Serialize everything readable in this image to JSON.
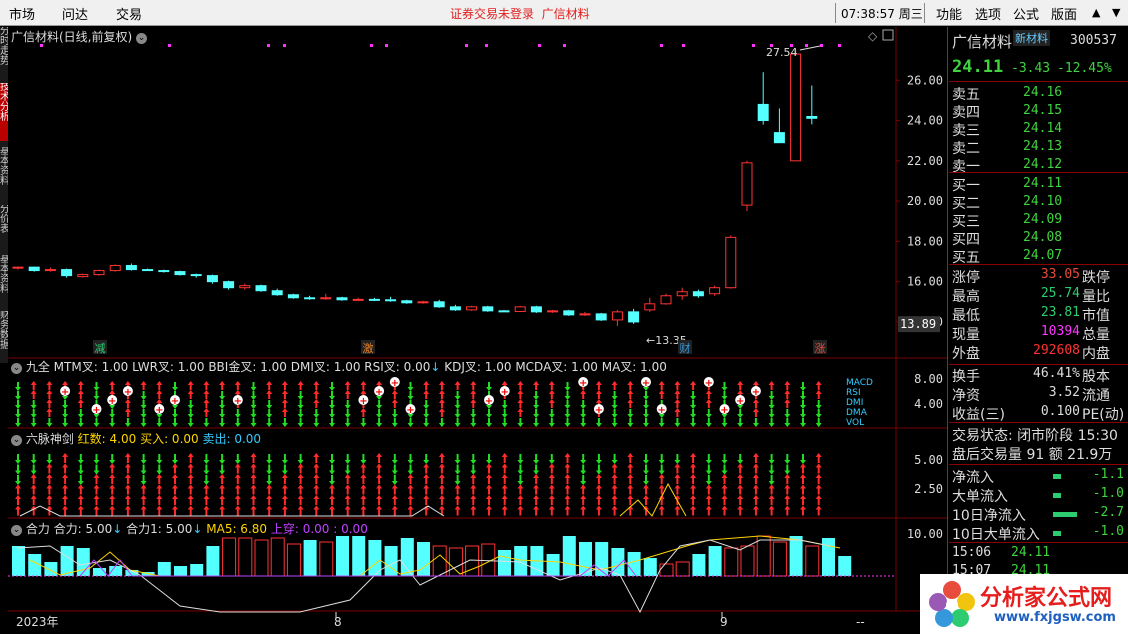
{
  "menu": {
    "left": [
      "市场",
      "问达",
      "交易"
    ],
    "right": [
      "功能",
      "选项",
      "公式",
      "版面"
    ],
    "notice": "证券交易未登录",
    "notice_stock": "广信材料",
    "clock": "07:38:57 周三"
  },
  "leftbar": [
    "分时走势",
    "技术分析",
    "基本资料",
    "分价表",
    "基本资料",
    "财务数据"
  ],
  "chart": {
    "title": "广信材料(日线,前复权)",
    "high_label": "27.54",
    "low_label": "13.35",
    "current_tag": "13.89",
    "y_ticks": [
      "26.00",
      "24.00",
      "22.00",
      "20.00",
      "18.00",
      "16.00",
      "14.00"
    ],
    "markers": [
      {
        "text": "减",
        "color": "#2ecc71"
      },
      {
        "text": "激",
        "color": "#e67e22"
      },
      {
        "text": "财",
        "color": "#3498db"
      },
      {
        "text": "涨",
        "color": "#e74c3c"
      }
    ],
    "x_labels": [
      "2023年",
      "8",
      "9"
    ]
  },
  "chart_data": {
    "type": "candlestick",
    "ylim": [
      13.5,
      27.8
    ],
    "candles": [
      [
        16.7,
        16.75,
        16.6,
        16.72
      ],
      [
        16.72,
        16.75,
        16.5,
        16.55
      ],
      [
        16.55,
        16.7,
        16.5,
        16.6
      ],
      [
        16.6,
        16.65,
        16.2,
        16.3
      ],
      [
        16.25,
        16.4,
        16.2,
        16.35
      ],
      [
        16.35,
        16.6,
        16.3,
        16.55
      ],
      [
        16.55,
        16.85,
        16.5,
        16.8
      ],
      [
        16.8,
        16.9,
        16.55,
        16.6
      ],
      [
        16.6,
        16.65,
        16.55,
        16.58
      ],
      [
        16.55,
        16.6,
        16.45,
        16.5
      ],
      [
        16.5,
        16.55,
        16.3,
        16.35
      ],
      [
        16.35,
        16.4,
        16.2,
        16.3
      ],
      [
        16.3,
        16.35,
        15.9,
        16.0
      ],
      [
        16.0,
        16.05,
        15.6,
        15.7
      ],
      [
        15.7,
        15.9,
        15.6,
        15.8
      ],
      [
        15.8,
        15.85,
        15.5,
        15.55
      ],
      [
        15.55,
        15.65,
        15.3,
        15.35
      ],
      [
        15.35,
        15.4,
        15.15,
        15.2
      ],
      [
        15.2,
        15.3,
        15.1,
        15.15
      ],
      [
        15.15,
        15.4,
        15.1,
        15.2
      ],
      [
        15.2,
        15.25,
        15.05,
        15.1
      ],
      [
        15.1,
        15.2,
        15.05,
        15.12
      ],
      [
        15.12,
        15.2,
        15.05,
        15.1
      ],
      [
        15.1,
        15.25,
        15.0,
        15.05
      ],
      [
        15.05,
        15.1,
        14.9,
        14.95
      ],
      [
        14.95,
        15.05,
        14.9,
        15.0
      ],
      [
        15.0,
        15.1,
        14.7,
        14.75
      ],
      [
        14.75,
        14.85,
        14.55,
        14.6
      ],
      [
        14.6,
        14.8,
        14.55,
        14.75
      ],
      [
        14.75,
        14.8,
        14.5,
        14.55
      ],
      [
        14.55,
        14.6,
        14.5,
        14.52
      ],
      [
        14.52,
        14.8,
        14.5,
        14.75
      ],
      [
        14.75,
        14.8,
        14.45,
        14.5
      ],
      [
        14.5,
        14.6,
        14.45,
        14.55
      ],
      [
        14.55,
        14.6,
        14.3,
        14.35
      ],
      [
        14.35,
        14.5,
        14.3,
        14.4
      ],
      [
        14.4,
        14.45,
        14.05,
        14.1
      ],
      [
        14.1,
        14.6,
        13.8,
        14.5
      ],
      [
        14.5,
        14.65,
        13.9,
        14.0
      ],
      [
        14.6,
        15.2,
        14.5,
        14.9
      ],
      [
        14.9,
        15.4,
        14.85,
        15.3
      ],
      [
        15.3,
        15.7,
        15.1,
        15.5
      ],
      [
        15.5,
        15.6,
        15.2,
        15.3
      ],
      [
        15.4,
        15.8,
        15.3,
        15.7
      ],
      [
        15.7,
        18.3,
        15.65,
        18.2
      ],
      [
        19.8,
        22.0,
        19.5,
        21.9
      ],
      [
        24.8,
        26.4,
        23.8,
        24.0
      ],
      [
        23.4,
        24.6,
        22.9,
        22.9
      ],
      [
        22.0,
        27.54,
        22.0,
        27.3
      ],
      [
        24.2,
        25.74,
        23.81,
        24.11
      ]
    ]
  },
  "ind1": {
    "title": "九全",
    "params": [
      "MTM叉: 1.00",
      "LWR叉: 1.00",
      "BBI金叉: 1.00",
      "DMI叉: 1.00",
      "RSI叉: 0.00",
      "KDJ叉: 1.00",
      "MCDA叉: 1.00",
      "MA叉: 1.00"
    ],
    "ticks": [
      "8.00",
      "4.00"
    ],
    "legend": [
      "MACD",
      "RSI",
      "DMI",
      "DMA",
      "VOL"
    ]
  },
  "ind2": {
    "title": "六脉神剑",
    "params": [
      {
        "t": "红数: 4.00",
        "c": "#ffd400"
      },
      {
        "t": "买入: 0.00",
        "c": "#ffd400"
      },
      {
        "t": "卖出: 0.00",
        "c": "#33ccff"
      }
    ],
    "ticks": [
      "5.00",
      "2.50"
    ]
  },
  "ind3": {
    "title": "合力",
    "params": [
      {
        "t": "合力: 5.00",
        "c": "#ddd"
      },
      {
        "t": "合力1: 5.00",
        "c": "#ddd"
      },
      {
        "t": "MA5: 6.80",
        "c": "#ffd400"
      },
      {
        "t": "上穿: 0.00 : 0.00",
        "c": "#c040ff"
      }
    ],
    "ticks": [
      "10.00"
    ]
  },
  "quote": {
    "name": "广信材料",
    "tag": "新材料",
    "code": "300537",
    "price": "24.11",
    "change": "-3.43",
    "pct": "-12.45%",
    "sell": [
      [
        "卖五",
        "24.16",
        ""
      ],
      [
        "卖四",
        "24.15",
        ""
      ],
      [
        "卖三",
        "24.14",
        ""
      ],
      [
        "卖二",
        "24.13",
        ""
      ],
      [
        "卖一",
        "24.12",
        ""
      ]
    ],
    "buy": [
      [
        "买一",
        "24.11",
        ""
      ],
      [
        "买二",
        "24.10",
        ""
      ],
      [
        "买三",
        "24.09",
        ""
      ],
      [
        "买四",
        "24.08",
        ""
      ],
      [
        "买五",
        "24.07",
        ""
      ]
    ],
    "stats": [
      [
        "涨停",
        "33.05",
        "#e74c3c",
        "跌停"
      ],
      [
        "最高",
        "25.74",
        "#2ecc71",
        "量比"
      ],
      [
        "最低",
        "23.81",
        "#2ecc71",
        "市值"
      ],
      [
        "现量",
        "10394",
        "#ff33ff",
        "总量"
      ],
      [
        "外盘",
        "292608",
        "#ff3333",
        "内盘"
      ]
    ],
    "stats2": [
      [
        "换手",
        "46.41%",
        "#ddd",
        "股本"
      ],
      [
        "净资",
        "3.52",
        "#ddd",
        "流通"
      ],
      [
        "收益(三)",
        "0.100",
        "#ddd",
        "PE(动)"
      ]
    ],
    "trade_status": "交易状态: 闭市阶段 15:30",
    "after": "盘后交易量 91 额 21.9万",
    "flows": [
      [
        "净流入",
        "-1.1"
      ],
      [
        "大单流入",
        "-1.0"
      ],
      [
        "10日净流入",
        "-2.7"
      ],
      [
        "10日大单流入",
        "-1.0"
      ]
    ],
    "ticks": [
      [
        "15:06",
        "24.11"
      ],
      [
        "15:07",
        "24.11"
      ]
    ]
  },
  "logo": {
    "cn": "分析家公式网",
    "url": "www.fxjgsw.com"
  },
  "colors": {
    "up": "#ff3333",
    "down": "#54ffff",
    "ma": "#ffd400",
    "grid": "#7a0000"
  }
}
